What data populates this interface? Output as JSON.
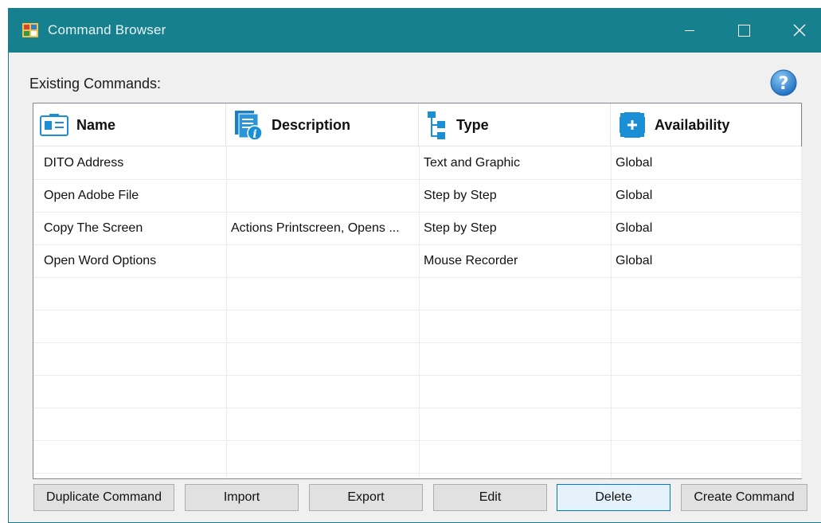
{
  "window": {
    "title": "Command Browser",
    "icons": {
      "app": "app-icon",
      "minimize": "minimize-icon",
      "maximize": "maximize-icon",
      "close": "close-icon"
    }
  },
  "section_label": "Existing Commands:",
  "help_icon": "help-icon",
  "columns": [
    {
      "label": "Name",
      "icon": "name-card-icon"
    },
    {
      "label": "Description",
      "icon": "description-document-icon"
    },
    {
      "label": "Type",
      "icon": "type-tree-icon"
    },
    {
      "label": "Availability",
      "icon": "availability-icon"
    }
  ],
  "rows": [
    {
      "name": "DITO Address",
      "description": "",
      "type": "Text and Graphic",
      "availability": "Global"
    },
    {
      "name": "Open Adobe File",
      "description": "",
      "type": "Step by Step",
      "availability": "Global"
    },
    {
      "name": "Copy The Screen",
      "description": "Actions Printscreen, Opens ...",
      "type": "Step by Step",
      "availability": "Global"
    },
    {
      "name": "Open Word Options",
      "description": "",
      "type": "Mouse Recorder",
      "availability": "Global"
    }
  ],
  "buttons": {
    "duplicate": "Duplicate Command",
    "import": "Import",
    "export": "Export",
    "edit": "Edit",
    "delete": "Delete",
    "create": "Create Command"
  },
  "colors": {
    "titlebar": "#17808e",
    "accent_icon": "#1a8fd6",
    "focus_border": "#0078d7"
  }
}
